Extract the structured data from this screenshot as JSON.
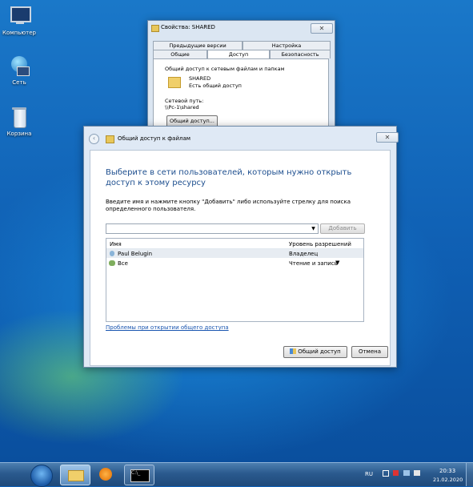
{
  "desktop": {
    "icons": [
      {
        "label": "Компьютер",
        "icon": "computer-icon"
      },
      {
        "label": "Сеть",
        "icon": "network-icon"
      },
      {
        "label": "Корзина",
        "icon": "recycle-bin-icon"
      }
    ]
  },
  "properties_window": {
    "title": "Свойства: SHARED",
    "tabs_top": [
      "Предыдущие версии",
      "Настройка"
    ],
    "tabs_bottom": [
      "Общие",
      "Доступ",
      "Безопасность"
    ],
    "active_tab": "Доступ",
    "group_label": "Общий доступ к сетевым файлам и папкам",
    "folder_name": "SHARED",
    "folder_status": "Есть общий доступ",
    "network_path_label": "Сетевой путь:",
    "network_path": "\\\\Pc-1\\shared",
    "share_button": "Общий доступ..."
  },
  "share_dialog": {
    "title": "Общий доступ к файлам",
    "heading": "Выберите в сети пользователей, которым нужно открыть доступ к этому ресурсу",
    "instruction": "Введите имя и нажмите кнопку \"Добавить\" либо используйте стрелку для поиска определенного пользователя.",
    "name_input_value": "",
    "add_button": "Добавить",
    "columns": [
      "Имя",
      "Уровень разрешений"
    ],
    "rows": [
      {
        "name": "Paul Belugin",
        "permission": "Владелец",
        "icon": "user-icon"
      },
      {
        "name": "Все",
        "permission": "Чтение и запись",
        "icon": "group-icon",
        "has_dropdown": true
      }
    ],
    "help_link": "Проблемы при открытии общего доступа",
    "share_button": "Общий доступ",
    "cancel_button": "Отмена"
  },
  "taskbar": {
    "language": "RU",
    "time": "20:33",
    "date": "21.02.2020"
  }
}
